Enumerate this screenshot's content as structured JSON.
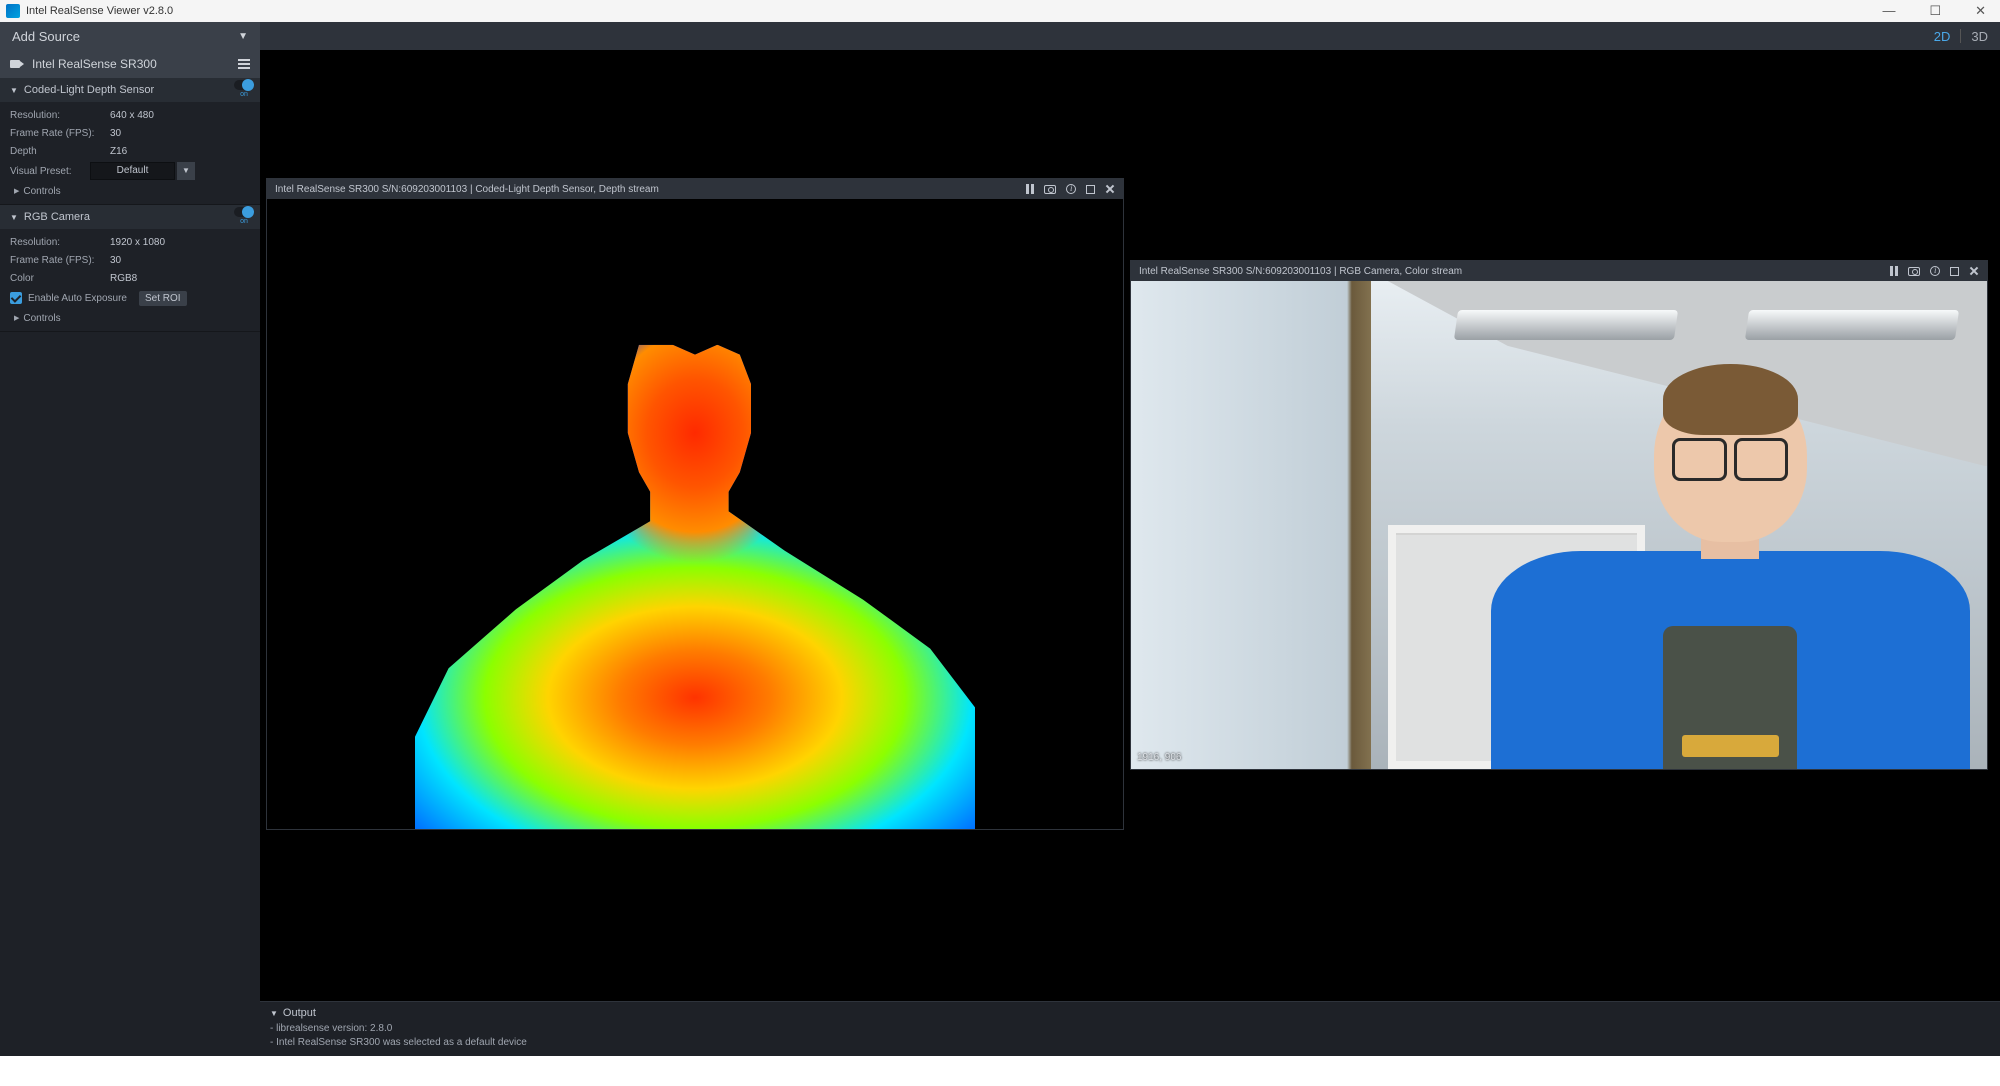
{
  "window": {
    "title": "Intel RealSense Viewer v2.8.0",
    "controls": {
      "min": "—",
      "max": "☐",
      "close": "✕"
    }
  },
  "header": {
    "add_source": "Add Source",
    "view2d": "2D",
    "view3d": "3D"
  },
  "device": {
    "name": "Intel RealSense SR300"
  },
  "depth_sensor": {
    "title": "Coded-Light Depth Sensor",
    "toggle_state": "on",
    "resolution_label": "Resolution:",
    "resolution": "640 x 480",
    "fps_label": "Frame Rate (FPS):",
    "fps": "30",
    "format_label": "Depth",
    "format": "Z16",
    "visual_preset_label": "Visual Preset:",
    "visual_preset": "Default",
    "controls_label": "Controls"
  },
  "rgb_camera": {
    "title": "RGB Camera",
    "toggle_state": "on",
    "resolution_label": "Resolution:",
    "resolution": "1920 x 1080",
    "fps_label": "Frame Rate (FPS):",
    "fps": "30",
    "format_label": "Color",
    "format": "RGB8",
    "auto_exposure_label": "Enable Auto Exposure",
    "set_roi_label": "Set ROI",
    "controls_label": "Controls"
  },
  "streams": {
    "depth_title": "Intel RealSense SR300 S/N:609203001103 | Coded-Light Depth Sensor, Depth stream",
    "color_title": "Intel RealSense SR300 S/N:609203001103 | RGB Camera, Color stream",
    "color_coord": "1916, 906"
  },
  "output": {
    "title": "Output",
    "lines": [
      "- librealsense version: 2.8.0",
      "- Intel RealSense SR300 was selected as a default device"
    ]
  }
}
